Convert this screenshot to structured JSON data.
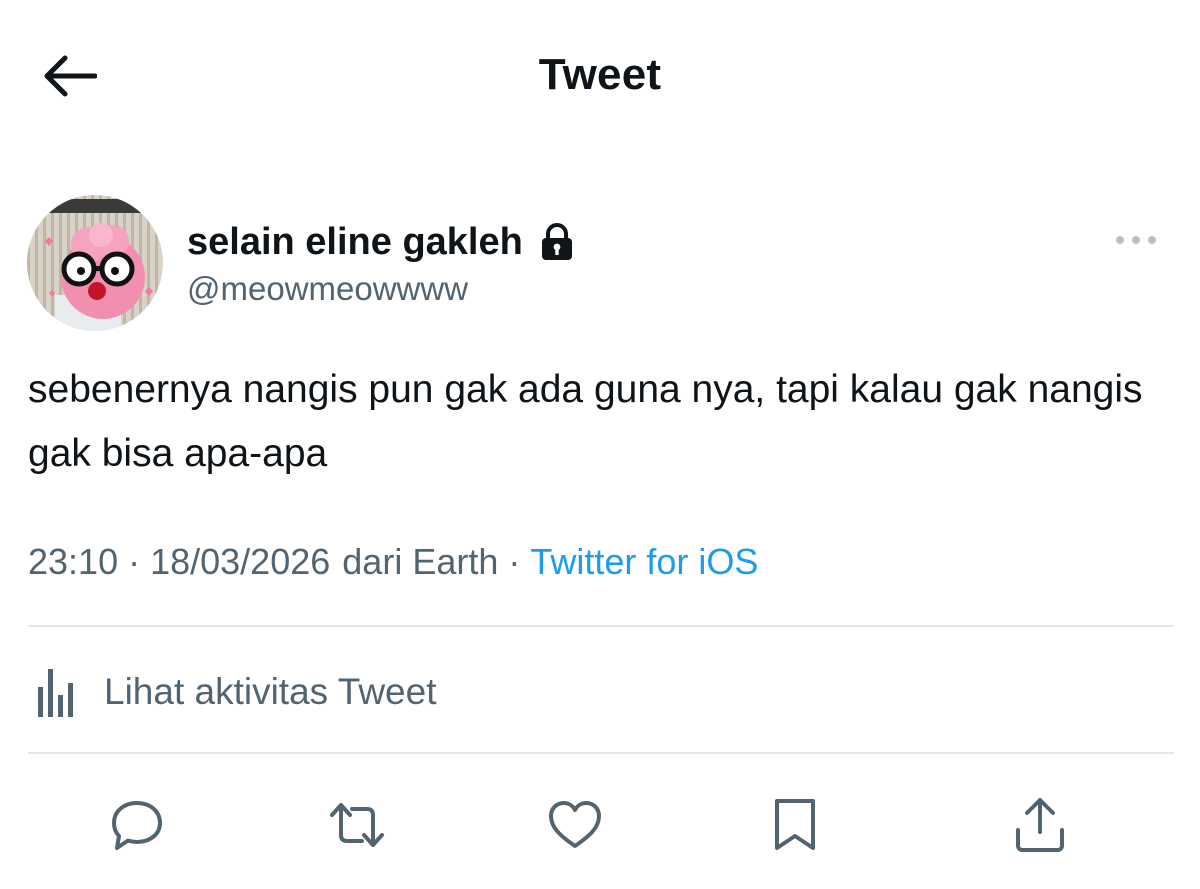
{
  "header": {
    "title": "Tweet",
    "back_icon": "arrow-left-icon"
  },
  "tweet": {
    "author": {
      "display_name": "selain eline gakleh",
      "handle": "@meowmeowwww",
      "protected_icon": "lock-icon",
      "avatar_icon": "avatar-image"
    },
    "more_icon": "more-horizontal-icon",
    "text": "sebenernya nangis pun gak ada guna nya, tapi kalau gak nangis gak bisa apa-apa",
    "meta": {
      "time": "23:10",
      "date": "18/03/2026",
      "location": "dari Earth",
      "separator": "·",
      "source": "Twitter for iOS"
    },
    "activity": {
      "label": "Lihat aktivitas Tweet",
      "icon": "analytics-bar-icon"
    },
    "actions": [
      {
        "name": "reply",
        "icon": "reply-icon"
      },
      {
        "name": "retweet",
        "icon": "retweet-icon"
      },
      {
        "name": "like",
        "icon": "heart-icon"
      },
      {
        "name": "bookmark",
        "icon": "bookmark-icon"
      },
      {
        "name": "share",
        "icon": "share-icon"
      }
    ]
  },
  "colors": {
    "text_primary": "#0f1419",
    "text_secondary": "#536471",
    "link": "#1d9bf0",
    "divider": "#e3e7ea"
  }
}
